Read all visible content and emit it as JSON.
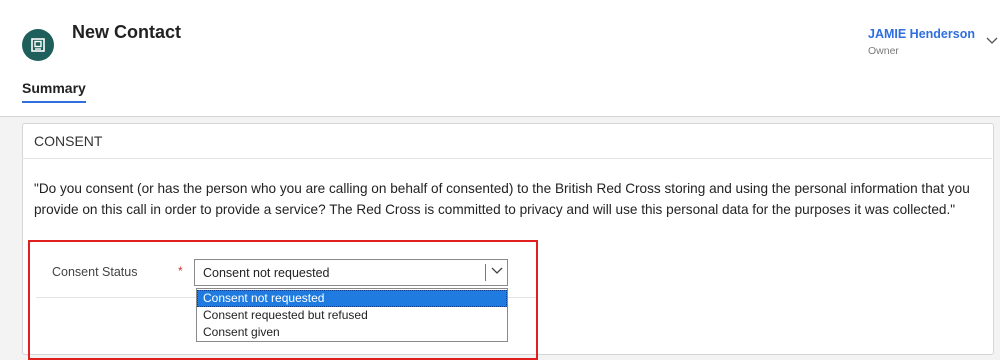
{
  "header": {
    "title": "New Contact",
    "owner_name": "JAMIE Henderson",
    "owner_label": "Owner"
  },
  "tabs": [
    {
      "label": "Summary",
      "active": true
    }
  ],
  "section": {
    "title": "CONSENT",
    "text": "\"Do you consent (or has the person who you are calling on behalf of consented) to the British Red Cross storing and using the personal information that you provide on this call in order to provide a service? The Red Cross is committed to privacy and will use this personal data for the purposes it was collected.\""
  },
  "consent_field": {
    "label": "Consent Status",
    "required_marker": "*",
    "value": "Consent not requested",
    "options": [
      {
        "label": "Consent not requested",
        "selected": true
      },
      {
        "label": "Consent requested but refused",
        "selected": false
      },
      {
        "label": "Consent given",
        "selected": false
      }
    ]
  },
  "colors": {
    "accent": "#2f6fde",
    "avatar_bg": "#1f5f5b",
    "highlight_border": "#e02020",
    "selected_option_bg": "#1f7be0",
    "required": "#d13438"
  },
  "icons": {
    "avatar": "contact-card-icon",
    "owner_expand": "chevron-down-icon",
    "select_expand": "chevron-down-icon"
  }
}
